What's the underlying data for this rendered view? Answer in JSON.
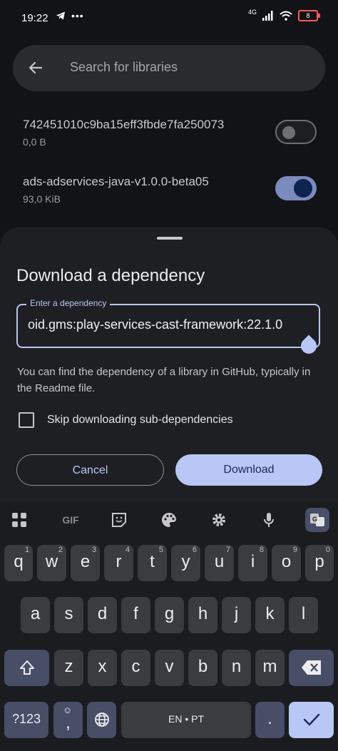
{
  "status": {
    "time": "19:22",
    "network": "4G",
    "battery": "8"
  },
  "search": {
    "placeholder": "Search for libraries"
  },
  "libraries": [
    {
      "name": "742451010c9ba15eff3fbde7fa250073",
      "size": "0,0 B",
      "enabled": false
    },
    {
      "name": "ads-adservices-java-v1.0.0-beta05",
      "size": "93,0 KiB",
      "enabled": true
    }
  ],
  "dialog": {
    "title": "Download a dependency",
    "field_label": "Enter a dependency",
    "field_value": "oid.gms:play-services-cast-framework:22.1.0",
    "helper": "You can find the dependency of a library in GitHub, typically in the Readme file.",
    "checkbox_label": "Skip downloading sub-dependencies",
    "cancel": "Cancel",
    "download": "Download"
  },
  "keyboard": {
    "toolbar": {
      "gif": "GIF"
    },
    "row1": [
      {
        "k": "q",
        "h": "1"
      },
      {
        "k": "w",
        "h": "2"
      },
      {
        "k": "e",
        "h": "3"
      },
      {
        "k": "r",
        "h": "4"
      },
      {
        "k": "t",
        "h": "5"
      },
      {
        "k": "y",
        "h": "6"
      },
      {
        "k": "u",
        "h": "7"
      },
      {
        "k": "i",
        "h": "8"
      },
      {
        "k": "o",
        "h": "9"
      },
      {
        "k": "p",
        "h": "0"
      }
    ],
    "row2": [
      "a",
      "s",
      "d",
      "f",
      "g",
      "h",
      "j",
      "k",
      "l"
    ],
    "row3": [
      "z",
      "x",
      "c",
      "v",
      "b",
      "n",
      "m"
    ],
    "symbols": "?123",
    "space": "EN • PT",
    "comma": ",",
    "period": "."
  },
  "colors": {
    "accent": "#b8c7f5",
    "background": "#121316",
    "sheet": "#1e1f23"
  }
}
